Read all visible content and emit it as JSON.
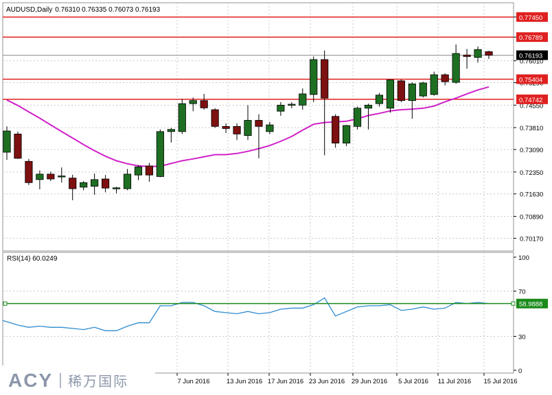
{
  "header": {
    "symbol": "AUDUSD,Daily",
    "ohlc": "0.76310 0.76335 0.76073 0.76193"
  },
  "chart_data": [
    {
      "type": "candlestick",
      "title": "AUDUSD,Daily",
      "ylim": [
        0.6975,
        0.7792
      ],
      "yticks": [
        "0.77450",
        "0.76789",
        "0.76010",
        "0.75290",
        "0.74550",
        "0.73810",
        "0.73090",
        "0.72350",
        "0.71630",
        "0.70890",
        "0.70170"
      ],
      "xticks": [
        "7 Jun 2016",
        "13 Jun 2016",
        "17 Jun 2016",
        "23 Jun 2016",
        "29 Jun 2016",
        "5 Jul 2016",
        "11 Jul 2016",
        "15 Jul 2016"
      ],
      "current_price": "0.76193",
      "horizontal_levels": [
        "0.77450",
        "0.76789",
        "0.75404",
        "0.74742"
      ],
      "candles": [
        {
          "o": 0.73,
          "h": 0.7385,
          "l": 0.7275,
          "c": 0.737
        },
        {
          "o": 0.736,
          "h": 0.7368,
          "l": 0.7278,
          "c": 0.728
        },
        {
          "o": 0.727,
          "h": 0.7278,
          "l": 0.7192,
          "c": 0.72
        },
        {
          "o": 0.721,
          "h": 0.724,
          "l": 0.7178,
          "c": 0.7228
        },
        {
          "o": 0.7228,
          "h": 0.7236,
          "l": 0.7205,
          "c": 0.7212
        },
        {
          "o": 0.722,
          "h": 0.725,
          "l": 0.72,
          "c": 0.7222
        },
        {
          "o": 0.7215,
          "h": 0.7226,
          "l": 0.7142,
          "c": 0.718
        },
        {
          "o": 0.7185,
          "h": 0.7205,
          "l": 0.7175,
          "c": 0.72
        },
        {
          "o": 0.7188,
          "h": 0.723,
          "l": 0.716,
          "c": 0.721
        },
        {
          "o": 0.7212,
          "h": 0.7225,
          "l": 0.7168,
          "c": 0.7182
        },
        {
          "o": 0.718,
          "h": 0.7186,
          "l": 0.7165,
          "c": 0.7183
        },
        {
          "o": 0.718,
          "h": 0.7245,
          "l": 0.7175,
          "c": 0.7228
        },
        {
          "o": 0.7225,
          "h": 0.7258,
          "l": 0.7208,
          "c": 0.7252
        },
        {
          "o": 0.7255,
          "h": 0.7265,
          "l": 0.7203,
          "c": 0.7225
        },
        {
          "o": 0.722,
          "h": 0.7375,
          "l": 0.7218,
          "c": 0.7368
        },
        {
          "o": 0.7368,
          "h": 0.738,
          "l": 0.7332,
          "c": 0.7375
        },
        {
          "o": 0.7368,
          "h": 0.7475,
          "l": 0.736,
          "c": 0.746
        },
        {
          "o": 0.746,
          "h": 0.748,
          "l": 0.7435,
          "c": 0.747
        },
        {
          "o": 0.747,
          "h": 0.7492,
          "l": 0.744,
          "c": 0.7446
        },
        {
          "o": 0.744,
          "h": 0.7445,
          "l": 0.738,
          "c": 0.7385
        },
        {
          "o": 0.7385,
          "h": 0.7395,
          "l": 0.7363,
          "c": 0.7378
        },
        {
          "o": 0.7385,
          "h": 0.7395,
          "l": 0.734,
          "c": 0.736
        },
        {
          "o": 0.7355,
          "h": 0.7455,
          "l": 0.734,
          "c": 0.7405
        },
        {
          "o": 0.7405,
          "h": 0.7425,
          "l": 0.728,
          "c": 0.7385
        },
        {
          "o": 0.7368,
          "h": 0.74,
          "l": 0.736,
          "c": 0.739
        },
        {
          "o": 0.7435,
          "h": 0.7465,
          "l": 0.742,
          "c": 0.7455
        },
        {
          "o": 0.7455,
          "h": 0.7465,
          "l": 0.7445,
          "c": 0.7458
        },
        {
          "o": 0.7455,
          "h": 0.751,
          "l": 0.744,
          "c": 0.7492
        },
        {
          "o": 0.749,
          "h": 0.7615,
          "l": 0.7465,
          "c": 0.7605
        },
        {
          "o": 0.7605,
          "h": 0.7635,
          "l": 0.729,
          "c": 0.7478
        },
        {
          "o": 0.7418,
          "h": 0.7425,
          "l": 0.7315,
          "c": 0.733
        },
        {
          "o": 0.733,
          "h": 0.739,
          "l": 0.732,
          "c": 0.7388
        },
        {
          "o": 0.7385,
          "h": 0.745,
          "l": 0.7375,
          "c": 0.7445
        },
        {
          "o": 0.7445,
          "h": 0.746,
          "l": 0.7375,
          "c": 0.7455
        },
        {
          "o": 0.746,
          "h": 0.7495,
          "l": 0.745,
          "c": 0.7488
        },
        {
          "o": 0.7445,
          "h": 0.754,
          "l": 0.743,
          "c": 0.7538
        },
        {
          "o": 0.7535,
          "h": 0.754,
          "l": 0.7465,
          "c": 0.747
        },
        {
          "o": 0.747,
          "h": 0.753,
          "l": 0.741,
          "c": 0.7525
        },
        {
          "o": 0.7485,
          "h": 0.7532,
          "l": 0.748,
          "c": 0.7528
        },
        {
          "o": 0.749,
          "h": 0.7565,
          "l": 0.7486,
          "c": 0.7555
        },
        {
          "o": 0.7555,
          "h": 0.756,
          "l": 0.752,
          "c": 0.7532
        },
        {
          "o": 0.753,
          "h": 0.7655,
          "l": 0.7525,
          "c": 0.7625
        },
        {
          "o": 0.762,
          "h": 0.764,
          "l": 0.7575,
          "c": 0.7615
        },
        {
          "o": 0.7612,
          "h": 0.7648,
          "l": 0.7595,
          "c": 0.7638
        },
        {
          "o": 0.7631,
          "h": 0.7634,
          "l": 0.7607,
          "c": 0.7619
        }
      ],
      "series": [
        {
          "values": [
            0.7472,
            0.7454,
            0.7433,
            0.7412,
            0.739,
            0.7368,
            0.7347,
            0.7325,
            0.7305,
            0.7287,
            0.7272,
            0.7262,
            0.7255,
            0.7253,
            0.7254,
            0.7263,
            0.7272,
            0.7278,
            0.7285,
            0.7292,
            0.7292,
            0.7296,
            0.7303,
            0.7312,
            0.7322,
            0.7336,
            0.7352,
            0.7373,
            0.7392,
            0.7398,
            0.74,
            0.7402,
            0.741,
            0.7421,
            0.7428,
            0.7436,
            0.744,
            0.7442,
            0.7445,
            0.7452,
            0.7466,
            0.7478,
            0.7492,
            0.7505,
            0.7515
          ]
        }
      ]
    },
    {
      "type": "line",
      "title": "RSI(14) 60.0249",
      "ylim": [
        0,
        100
      ],
      "yticks": [
        "100",
        "70",
        "30",
        "0"
      ],
      "level_label": "58.9888",
      "series": [
        {
          "values": [
            43,
            40,
            38,
            39,
            38,
            38,
            37,
            36,
            38,
            35,
            35,
            39,
            42,
            42,
            57,
            57,
            60,
            60,
            57,
            52,
            51,
            50,
            52,
            50,
            51,
            54,
            55,
            55,
            58,
            64,
            48,
            52,
            56,
            57,
            57,
            58,
            53,
            54,
            56,
            54,
            55,
            60,
            59,
            60,
            59
          ]
        }
      ]
    }
  ],
  "colors": {
    "bull": "#1e6f22",
    "bear": "#7d1010",
    "level": "#e02020",
    "ma": "#d020c8",
    "rsi": "#2e8bd0",
    "rsi_level": "#1a8a1a"
  },
  "watermark": {
    "brand": "ACY",
    "chinese": "稀万国际"
  }
}
